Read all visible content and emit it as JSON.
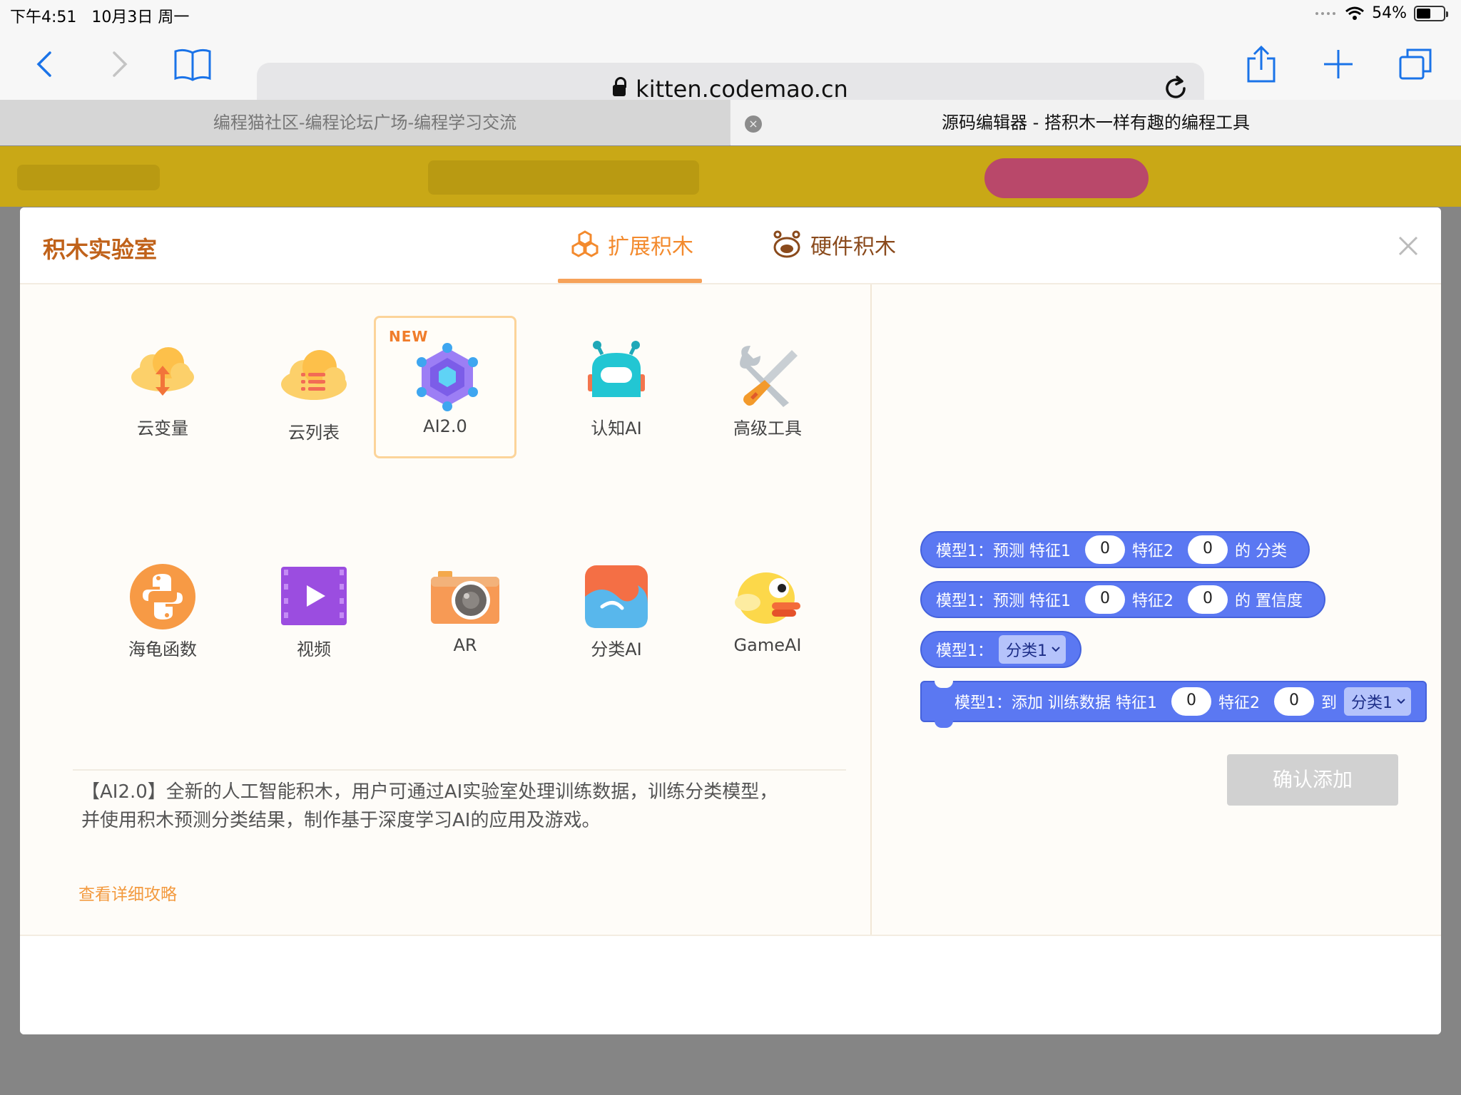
{
  "status_bar": {
    "time": "下午4:51",
    "date": "10月3日 周一",
    "battery": "54%",
    "battery_level": 0.54
  },
  "browser": {
    "url": "kitten.codemao.cn",
    "tabs": [
      {
        "label": "编程猫社区-编程论坛广场-编程学习交流",
        "active": false
      },
      {
        "label": "源码编辑器 - 搭积木一样有趣的编程工具",
        "active": true
      }
    ],
    "close_tab_glyph": "×"
  },
  "modal": {
    "title": "积木实验室",
    "tabs": [
      {
        "label": "扩展积木",
        "active": true,
        "icon": "hexagon-cluster-icon"
      },
      {
        "label": "硬件积木",
        "active": false,
        "icon": "robot-face-icon"
      }
    ],
    "close_icon": "close-icon",
    "items": [
      {
        "label": "云变量",
        "icon": "cloud-variable-icon",
        "selected": false,
        "badge": ""
      },
      {
        "label": "云列表",
        "icon": "cloud-list-icon",
        "selected": false,
        "badge": ""
      },
      {
        "label": "AI2.0",
        "icon": "ai-network-icon",
        "selected": true,
        "badge": "NEW"
      },
      {
        "label": "认知AI",
        "icon": "robot-icon",
        "selected": false,
        "badge": ""
      },
      {
        "label": "高级工具",
        "icon": "tools-icon",
        "selected": false,
        "badge": ""
      },
      {
        "label": "海龟函数",
        "icon": "python-icon",
        "selected": false,
        "badge": ""
      },
      {
        "label": "视频",
        "icon": "video-icon",
        "selected": false,
        "badge": ""
      },
      {
        "label": "AR",
        "icon": "camera-icon",
        "selected": false,
        "badge": ""
      },
      {
        "label": "分类AI",
        "icon": "classify-wave-icon",
        "selected": false,
        "badge": ""
      },
      {
        "label": "GameAI",
        "icon": "flappy-bird-icon",
        "selected": false,
        "badge": ""
      }
    ],
    "description_line1": "【AI2.0】全新的人工智能积木，用户可通过AI实验室处理训练数据，训练分类模型，",
    "description_line2": "并使用积木预测分类结果，制作基于深度学习AI的应用及游戏。",
    "guide_link": "查看详细攻略",
    "confirm_button": "确认添加",
    "blocks": [
      {
        "parts": [
          "模型1：预测 特征1",
          "0",
          "特征2",
          "0",
          "的 分类"
        ]
      },
      {
        "parts": [
          "模型1：预测 特征1",
          "0",
          "特征2",
          "0",
          "的 置信度"
        ]
      },
      {
        "parts": [
          "模型1：",
          "分类1"
        ]
      },
      {
        "parts": [
          "模型1：添加 训练数据 特征1",
          "0",
          "特征2",
          "0",
          "到",
          "分类1"
        ]
      }
    ]
  },
  "colors": {
    "accent_orange": "#f38a2d",
    "title_brown": "#c0621a",
    "block_blue": "#5b78f2",
    "dropdown_bg": "#b5c3fb",
    "confirm_disabled": "#d1d1d1"
  }
}
